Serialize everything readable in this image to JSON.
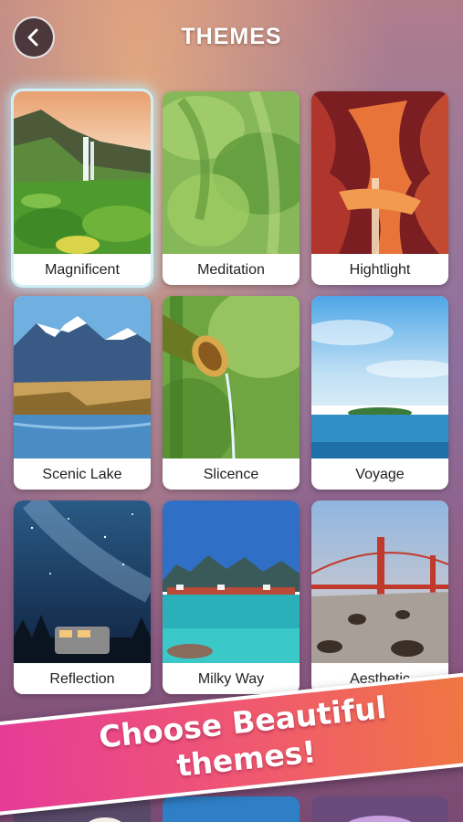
{
  "header": {
    "title": "THEMES",
    "back_icon": "chevron-left-icon"
  },
  "themes": [
    {
      "label": "Magnificent",
      "selected": true
    },
    {
      "label": "Meditation",
      "selected": false
    },
    {
      "label": "Hightlight",
      "selected": false
    },
    {
      "label": "Scenic Lake",
      "selected": false
    },
    {
      "label": "Slicence",
      "selected": false
    },
    {
      "label": "Voyage",
      "selected": false
    },
    {
      "label": "Reflection",
      "selected": false
    },
    {
      "label": "Milky Way",
      "selected": false
    },
    {
      "label": "Aesthetic",
      "selected": false
    }
  ],
  "promo": {
    "line1": "Choose Beautiful",
    "line2": "themes!"
  },
  "colors": {
    "selected_glow": "#cfeff5",
    "banner_start": "#e6399a",
    "banner_end": "#f07a3c"
  }
}
